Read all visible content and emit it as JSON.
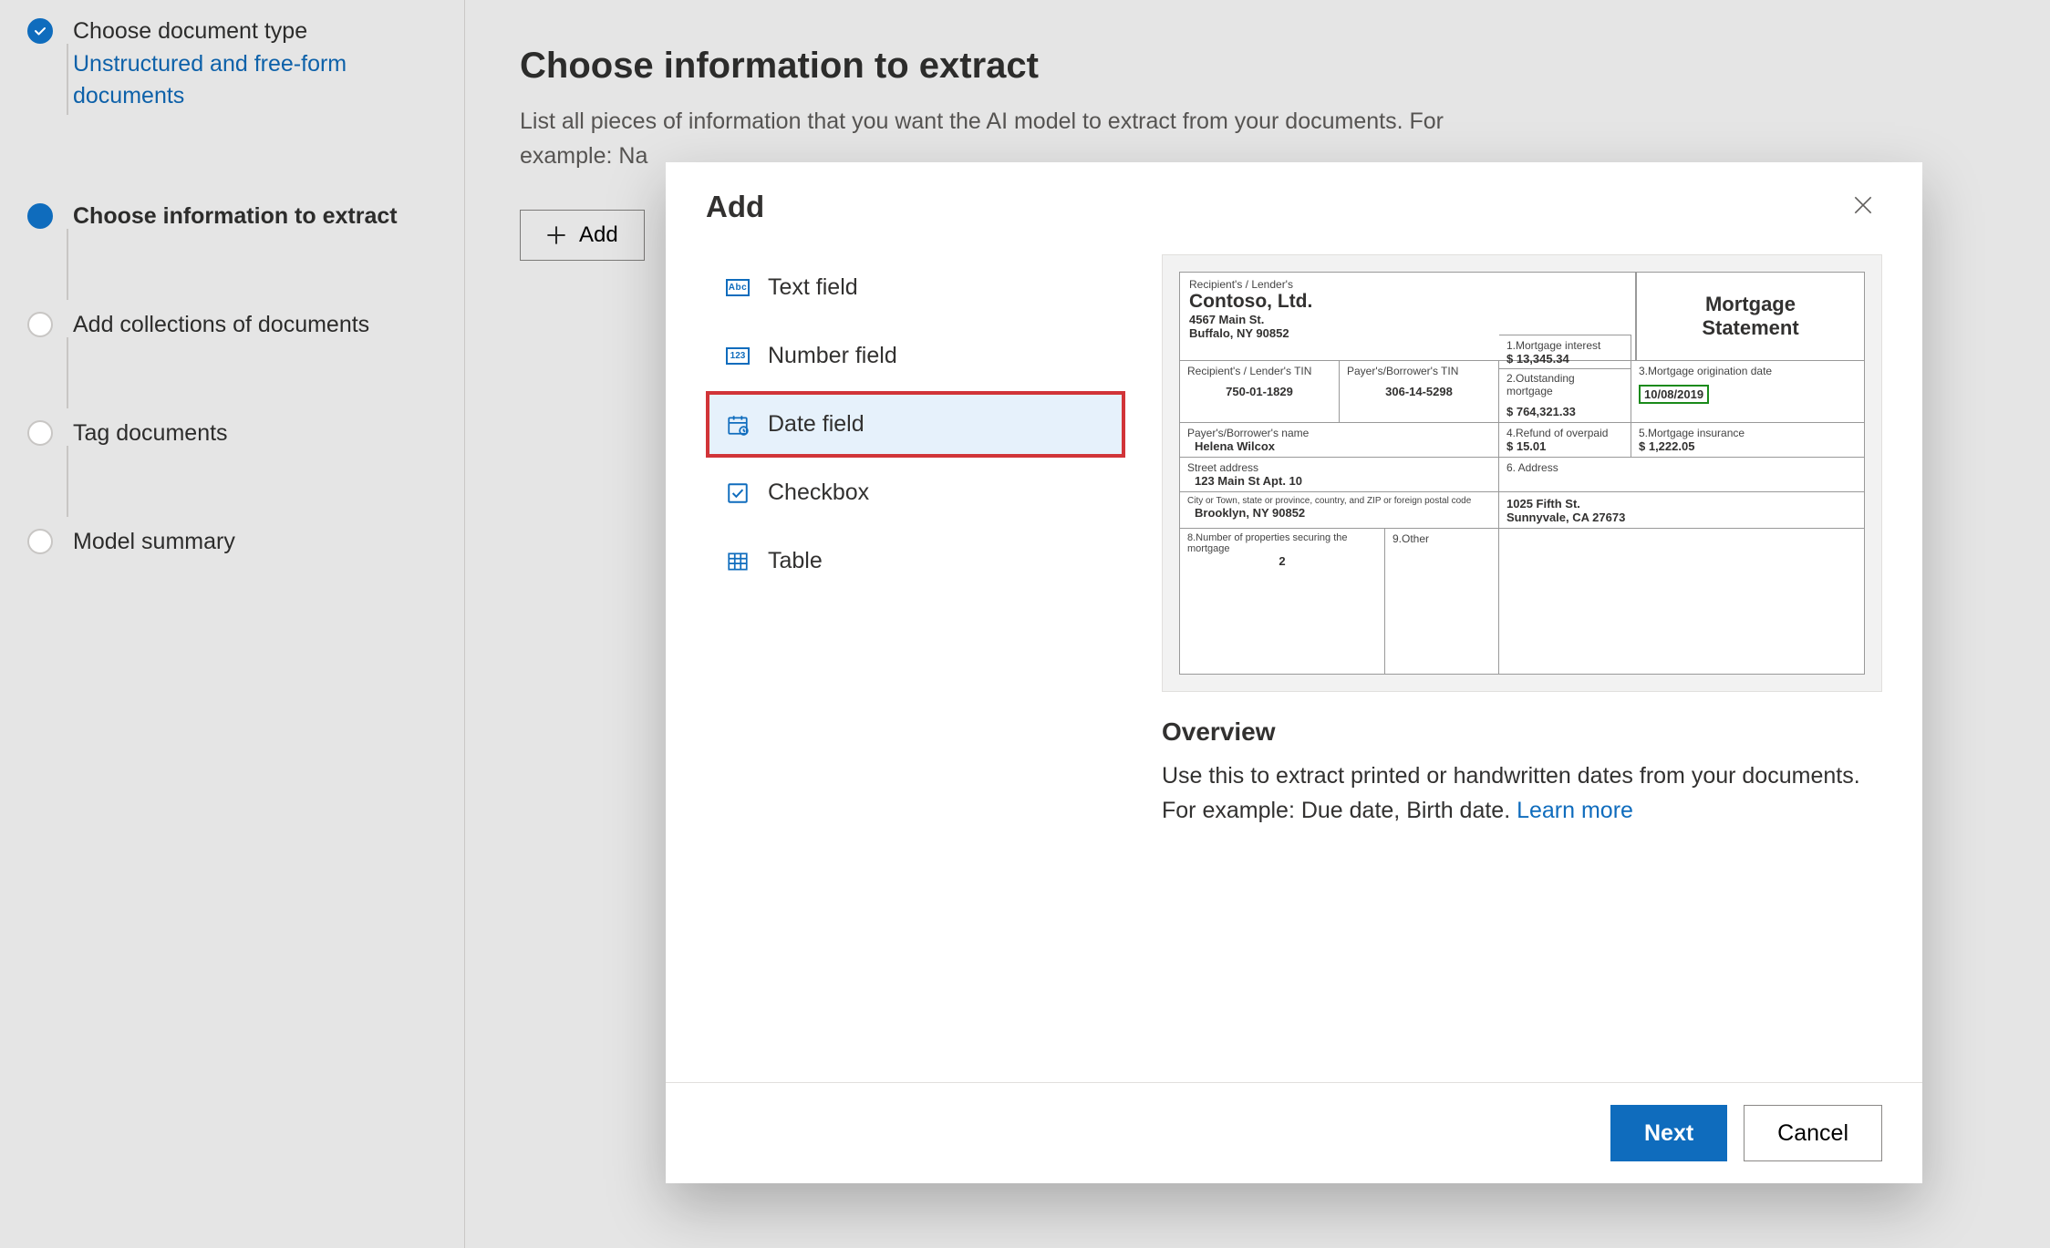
{
  "sidebar": {
    "steps": [
      {
        "title": "Choose document type",
        "sub": "Unstructured and free-form documents"
      },
      {
        "title": "Choose information to extract"
      },
      {
        "title": "Add collections of documents"
      },
      {
        "title": "Tag documents"
      },
      {
        "title": "Model summary"
      }
    ]
  },
  "main": {
    "heading": "Choose information to extract",
    "desc": "List all pieces of information that you want the AI model to extract from your documents. For example: Na",
    "add_label": "Add"
  },
  "modal": {
    "title": "Add",
    "fields": [
      {
        "label": "Text field"
      },
      {
        "label": "Number field"
      },
      {
        "label": "Date field"
      },
      {
        "label": "Checkbox"
      },
      {
        "label": "Table"
      }
    ],
    "overview_h": "Overview",
    "overview_p": "Use this to extract printed or handwritten dates from your documents. For example: Due date, Birth date. ",
    "learn_more": "Learn more",
    "next": "Next",
    "cancel": "Cancel"
  },
  "form": {
    "recipient_label": "Recipient's / Lender's",
    "company": "Contoso, Ltd.",
    "addr1": "4567 Main St.",
    "addr2": "Buffalo, NY 90852",
    "doc_title_1": "Mortgage",
    "doc_title_2": "Statement",
    "c1": {
      "label": "1.Mortgage interest",
      "value": "$  13,345.34"
    },
    "tin_recipient_label": "Recipient's / Lender's TIN",
    "tin_recipient": "750-01-1829",
    "tin_payer_label": "Payer's/Borrower's TIN",
    "tin_payer": "306-14-5298",
    "c2": {
      "label": "2.Outstanding mortgage",
      "value": "$  764,321.33"
    },
    "c3": {
      "label": "3.Mortgage origination date",
      "value": "10/08/2019"
    },
    "payer_name_label": "Payer's/Borrower's name",
    "payer_name": "Helena Wilcox",
    "c4": {
      "label": "4.Refund of overpaid",
      "value": "$  15.01"
    },
    "c5": {
      "label": "5.Mortgage insurance",
      "value": "$  1,222.05"
    },
    "street_label": "Street address",
    "street": "123 Main St Apt. 10",
    "c6": {
      "label": "6. Address"
    },
    "city_label": "City or Town, state or province, country, and ZIP or foreign postal code",
    "city": "Brooklyn, NY 90852",
    "lender_addr1": "1025 Fifth St.",
    "lender_addr2": "Sunnyvale, CA 27673",
    "c8_label": "8.Number of properties securing the mortgage",
    "c8_value": "2",
    "c9_label": "9.Other"
  }
}
